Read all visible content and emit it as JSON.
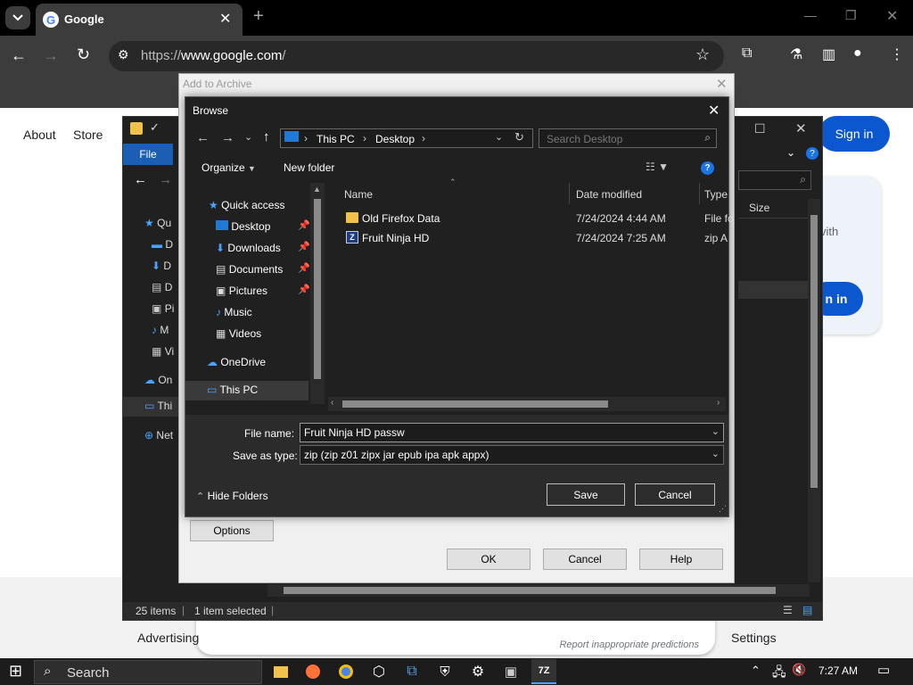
{
  "chrome": {
    "tab_title": "Google",
    "url_prefix": "https://",
    "url_host": "www.google.com",
    "url_path": "/"
  },
  "google": {
    "nav_about": "About",
    "nav_store": "Store",
    "sign_in": "Sign in",
    "footer_advertising": "Advertising",
    "footer_settings": "Settings",
    "report_text": "Report inappropriate predictions",
    "card_text_fragment": "vith",
    "card_button_fragment": "n in"
  },
  "explorer": {
    "ribbon_file": "File",
    "status_items": "25 items",
    "status_selected": "1 item selected",
    "size_header": "Size",
    "nav_items": [
      {
        "label": "Qu"
      },
      {
        "label": "D"
      },
      {
        "label": "D"
      },
      {
        "label": "D"
      },
      {
        "label": "Pi"
      },
      {
        "label": "M"
      },
      {
        "label": "Vi"
      },
      {
        "label": "On"
      },
      {
        "label": "Thi"
      },
      {
        "label": "Net"
      }
    ]
  },
  "archive": {
    "title": "Add to Archive",
    "options_label": "Options",
    "ok_label": "OK",
    "cancel_label": "Cancel",
    "help_label": "Help"
  },
  "browse": {
    "title": "Browse",
    "breadcrumb": [
      "This PC",
      "Desktop"
    ],
    "search_placeholder": "Search Desktop",
    "organize_label": "Organize",
    "new_folder_label": "New folder",
    "nav": [
      {
        "label": "Quick access"
      },
      {
        "label": "Desktop",
        "pinned": true
      },
      {
        "label": "Downloads",
        "pinned": true
      },
      {
        "label": "Documents",
        "pinned": true
      },
      {
        "label": "Pictures",
        "pinned": true
      },
      {
        "label": "Music"
      },
      {
        "label": "Videos"
      },
      {
        "label": "OneDrive"
      },
      {
        "label": "This PC"
      }
    ],
    "columns": {
      "name": "Name",
      "date": "Date modified",
      "type": "Type"
    },
    "files": [
      {
        "name": "Old Firefox Data",
        "date": "7/24/2024 4:44 AM",
        "type": "File fo",
        "icon": "folder-icon"
      },
      {
        "name": "Fruit Ninja HD",
        "date": "7/24/2024 7:25 AM",
        "type": "zip A",
        "icon": "zip-icon"
      }
    ],
    "file_name_label": "File name:",
    "file_name_value": "Fruit Ninja HD passw",
    "save_type_label": "Save as type:",
    "save_type_value": "zip (zip z01 zipx jar epub ipa apk appx)",
    "hide_folders_label": "Hide Folders",
    "save_label": "Save",
    "cancel_label": "Cancel"
  },
  "taskbar": {
    "search_label": "Search",
    "time": "7:27 AM"
  }
}
